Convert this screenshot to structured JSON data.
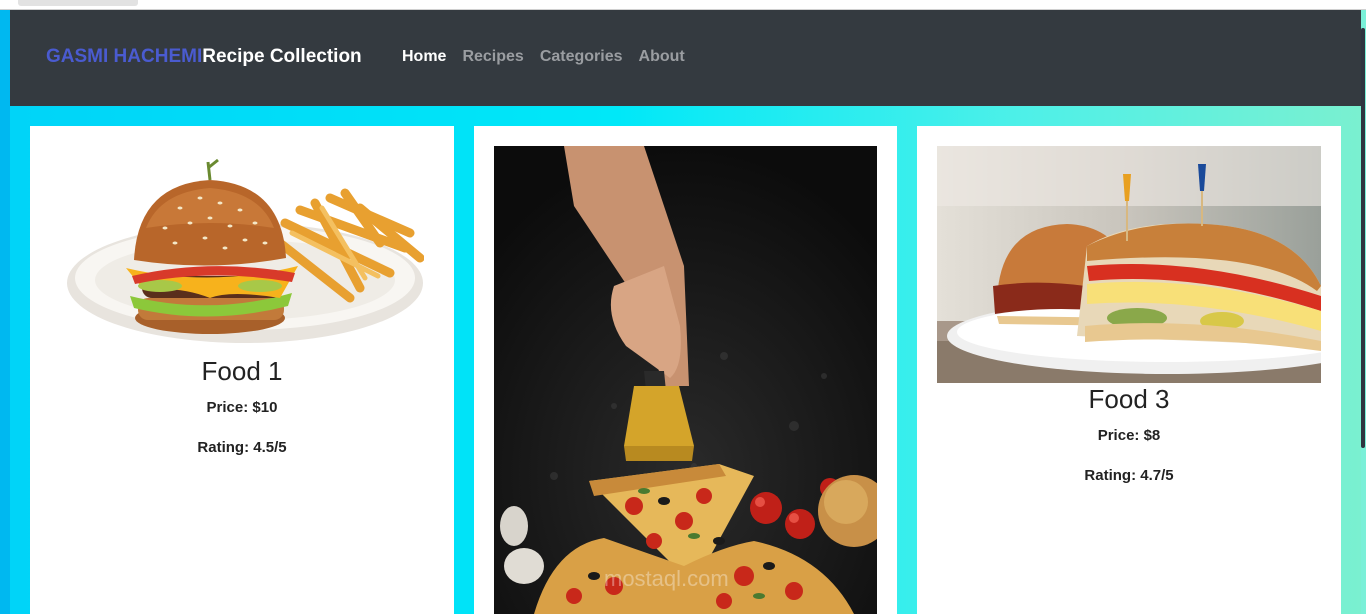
{
  "navbar": {
    "brand_name": "GASMI HACHEMI",
    "brand_title": "Recipe Collection",
    "links": [
      {
        "label": "Home",
        "active": true
      },
      {
        "label": "Recipes",
        "active": false
      },
      {
        "label": "Categories",
        "active": false
      },
      {
        "label": "About",
        "active": false
      }
    ]
  },
  "cards": [
    {
      "name": "Food 1",
      "price": "Price: $10",
      "rating": "Rating: 4.5/5",
      "image": "burger-and-fries-photo"
    },
    {
      "name": "",
      "price": "",
      "rating": "",
      "image": "pizza-slice-photo",
      "watermark": "mostaql.com"
    },
    {
      "name": "Food 3",
      "price": "Price: $8",
      "rating": "Rating: 4.7/5",
      "image": "sandwich-photo"
    }
  ],
  "colors": {
    "navbar_bg": "#343a40",
    "brand_accent": "#4a5bd0",
    "nav_active": "#ffffff",
    "nav_inactive": "#9a9da1",
    "gradient_start": "#00d4f8",
    "gradient_end": "#7af0d0"
  }
}
